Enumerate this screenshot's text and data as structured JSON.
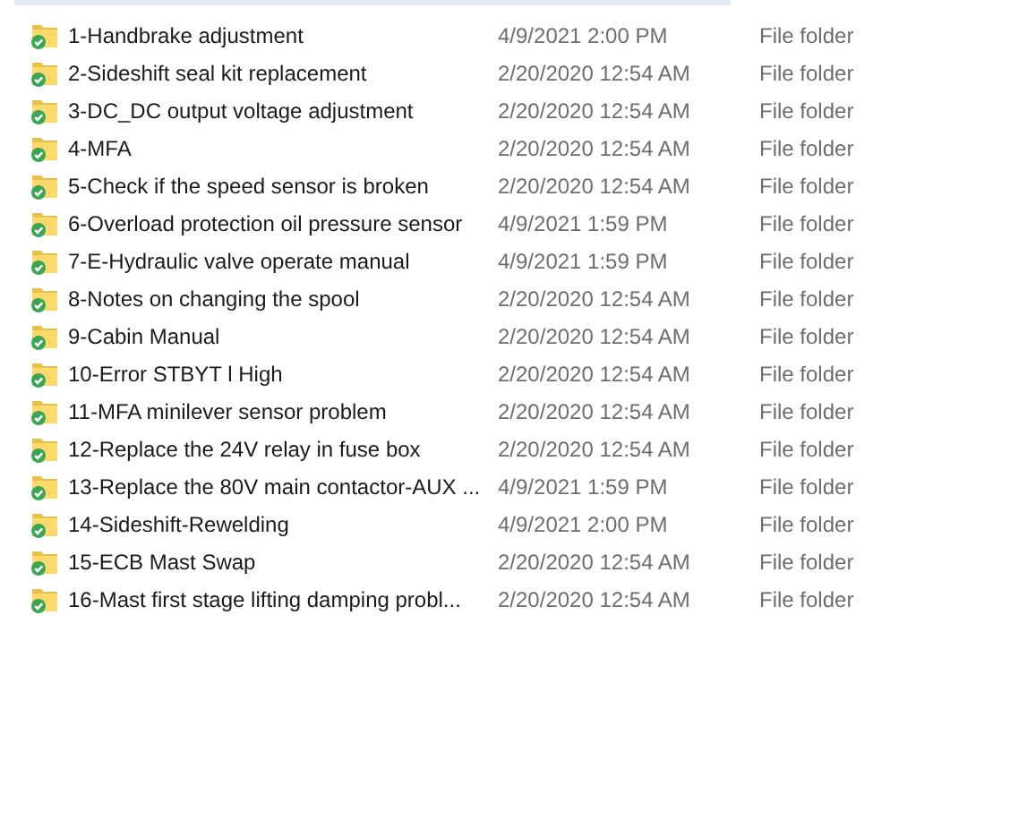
{
  "rows": [
    {
      "name": "1-Handbrake adjustment",
      "date": "4/9/2021 2:00 PM",
      "type": "File folder"
    },
    {
      "name": "2-Sideshift seal kit replacement",
      "date": "2/20/2020 12:54 AM",
      "type": "File folder"
    },
    {
      "name": "3-DC_DC output voltage adjustment",
      "date": "2/20/2020 12:54 AM",
      "type": "File folder"
    },
    {
      "name": "4-MFA",
      "date": "2/20/2020 12:54 AM",
      "type": "File folder"
    },
    {
      "name": "5-Check if the speed sensor is broken",
      "date": "2/20/2020 12:54 AM",
      "type": "File folder"
    },
    {
      "name": "6-Overload protection oil pressure sensor",
      "date": "4/9/2021 1:59 PM",
      "type": "File folder"
    },
    {
      "name": "7-E-Hydraulic valve operate manual",
      "date": "4/9/2021 1:59 PM",
      "type": "File folder"
    },
    {
      "name": "8-Notes on changing the spool",
      "date": "2/20/2020 12:54 AM",
      "type": "File folder"
    },
    {
      "name": "9-Cabin Manual",
      "date": "2/20/2020 12:54 AM",
      "type": "File folder"
    },
    {
      "name": "10-Error STBYT l High",
      "date": "2/20/2020 12:54 AM",
      "type": "File folder"
    },
    {
      "name": "11-MFA minilever sensor problem",
      "date": "2/20/2020 12:54 AM",
      "type": "File folder"
    },
    {
      "name": "12-Replace the 24V relay in fuse box",
      "date": "2/20/2020 12:54 AM",
      "type": "File folder"
    },
    {
      "name": "13-Replace the 80V main contactor-AUX ...",
      "date": "4/9/2021 1:59 PM",
      "type": "File folder"
    },
    {
      "name": "14-Sideshift-Rewelding",
      "date": "4/9/2021 2:00 PM",
      "type": "File folder"
    },
    {
      "name": "15-ECB Mast Swap",
      "date": "2/20/2020 12:54 AM",
      "type": "File folder"
    },
    {
      "name": "16-Mast first stage lifting damping probl...",
      "date": "2/20/2020 12:54 AM",
      "type": "File folder"
    }
  ]
}
